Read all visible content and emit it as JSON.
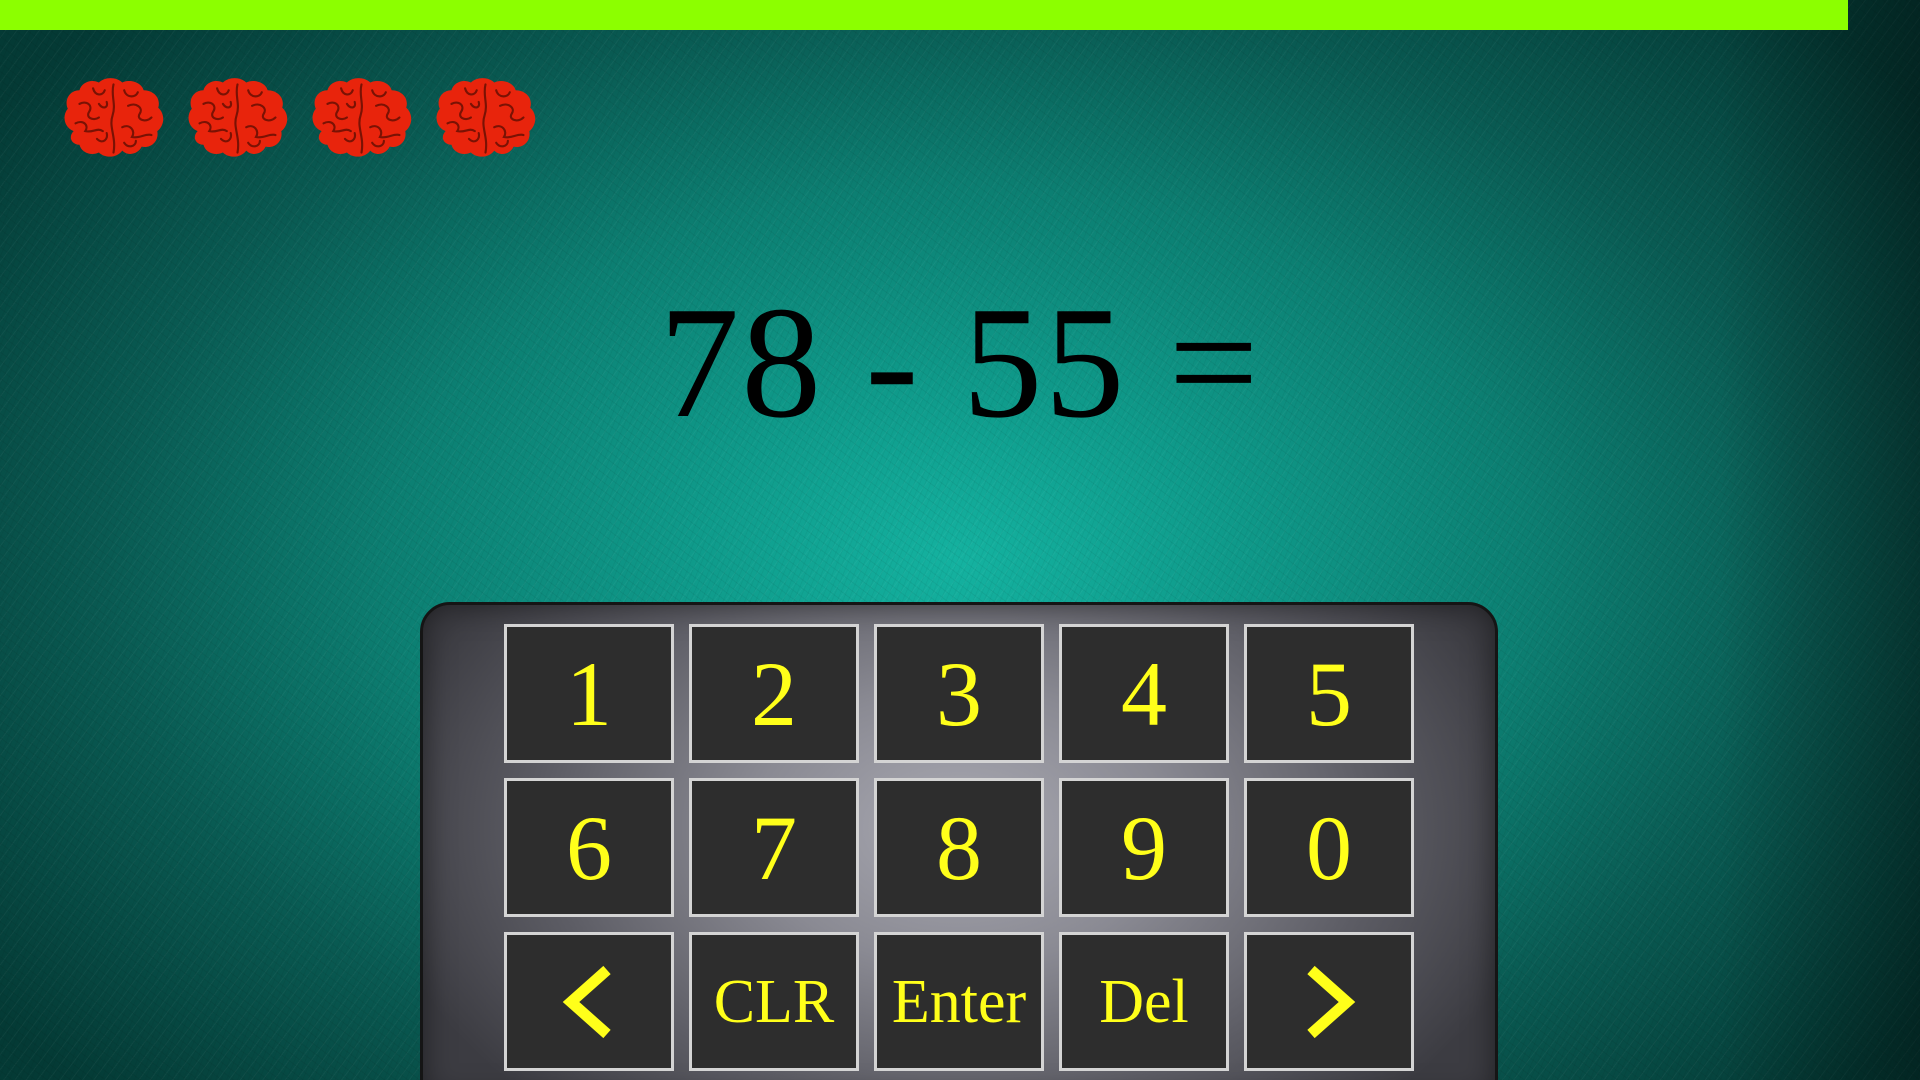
{
  "progress": {
    "fraction": 0.9625,
    "color": "#8cff00"
  },
  "lives": {
    "count": 4,
    "icon": "brain-icon",
    "color": "#e8240c"
  },
  "question": {
    "operand_a": "78",
    "operator": "-",
    "operand_b": "55",
    "equals": "="
  },
  "keypad": {
    "keys": [
      {
        "label": "1",
        "name": "key-1"
      },
      {
        "label": "2",
        "name": "key-2"
      },
      {
        "label": "3",
        "name": "key-3"
      },
      {
        "label": "4",
        "name": "key-4"
      },
      {
        "label": "5",
        "name": "key-5"
      },
      {
        "label": "6",
        "name": "key-6"
      },
      {
        "label": "7",
        "name": "key-7"
      },
      {
        "label": "8",
        "name": "key-8"
      },
      {
        "label": "9",
        "name": "key-9"
      },
      {
        "label": "0",
        "name": "key-0"
      },
      {
        "label": "",
        "name": "key-left-arrow",
        "icon": "chevron-left-icon"
      },
      {
        "label": "CLR",
        "name": "key-clear"
      },
      {
        "label": "Enter",
        "name": "key-enter"
      },
      {
        "label": "Del",
        "name": "key-delete"
      },
      {
        "label": "",
        "name": "key-right-arrow",
        "icon": "chevron-right-icon"
      }
    ],
    "key_text_color": "#ffff1a"
  }
}
